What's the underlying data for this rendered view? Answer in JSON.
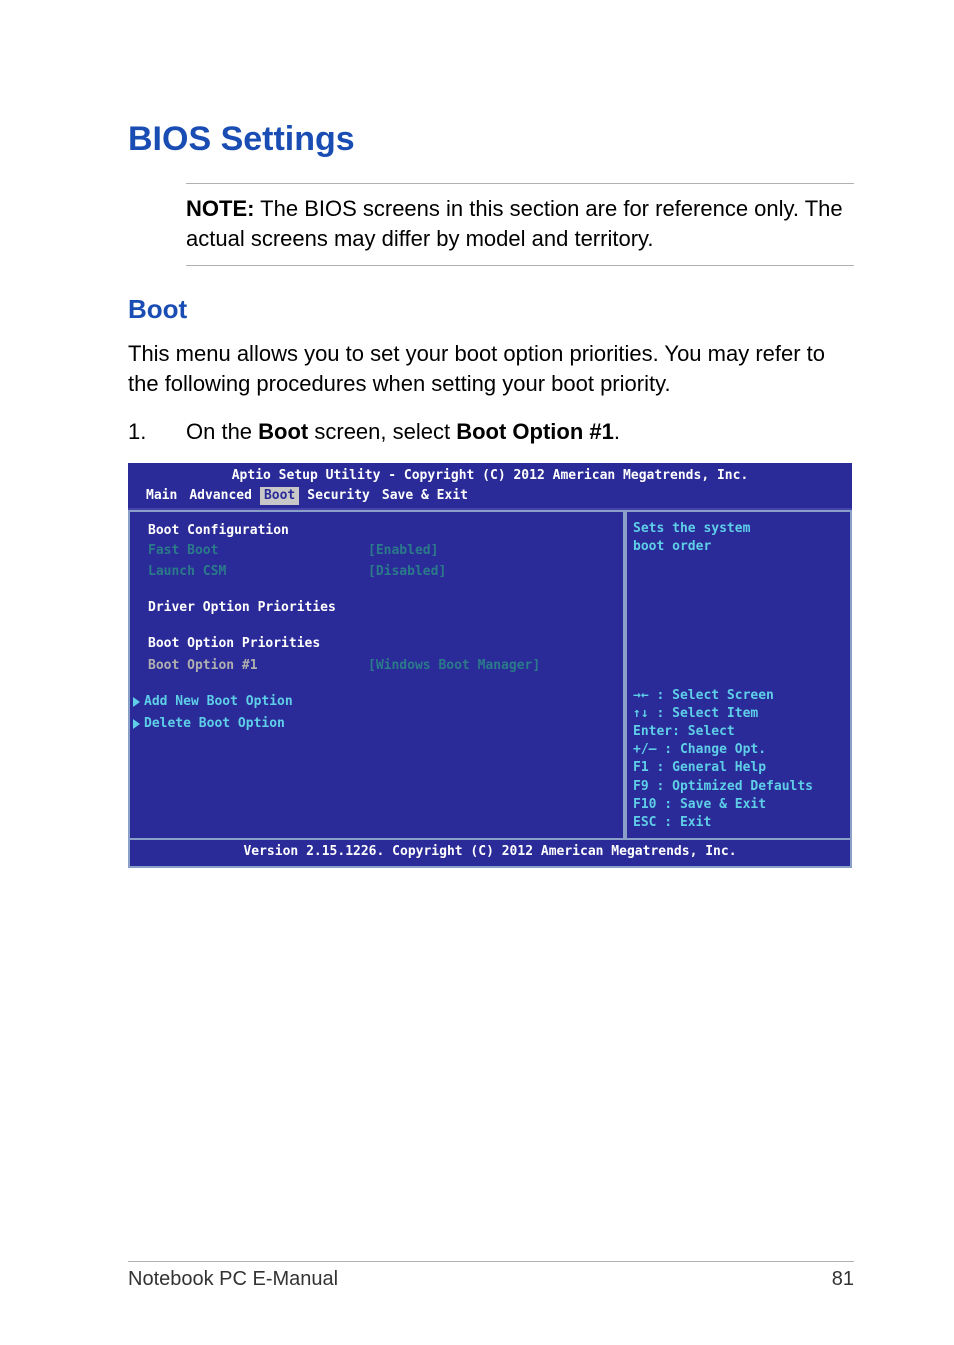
{
  "page": {
    "title": "BIOS Settings",
    "note_label": "NOTE:",
    "note_text": " The BIOS screens in this section are for reference only. The actual screens may differ by model and territory.",
    "sub_heading": "Boot",
    "intro": "This menu allows you to set your boot option priorities. You may refer to the following procedures when setting your boot priority.",
    "step_num": "1.",
    "step_pre": "On the ",
    "step_b1": "Boot",
    "step_mid": " screen, select ",
    "step_b2": "Boot Option #1",
    "step_post": "."
  },
  "bios": {
    "title": "Aptio Setup Utility - Copyright (C) 2012 American Megatrends, Inc.",
    "tabs": {
      "main": "Main",
      "advanced": "Advanced",
      "boot": "Boot",
      "security": "Security",
      "save_exit": "Save & Exit"
    },
    "active_tab": "Boot",
    "left": {
      "boot_config": "Boot Configuration",
      "fast_boot_label": "Fast Boot",
      "fast_boot_value": "[Enabled]",
      "launch_csm_label": "Launch CSM",
      "launch_csm_value": "[Disabled]",
      "driver_option": "Driver Option Priorities",
      "boot_option_prio": "Boot Option Priorities",
      "boot_option1_label": "Boot Option #1",
      "boot_option1_value": "[Windows Boot Manager]",
      "add_new": "Add New Boot Option",
      "delete": "Delete Boot Option"
    },
    "right": {
      "help1": "Sets the system",
      "help2": "boot order",
      "k1": "→←  : Select Screen",
      "k2": "↑↓  : Select Item",
      "k3": "Enter: Select",
      "k4": "+/—  : Change Opt.",
      "k5": "F1   : General Help",
      "k6": "F9   : Optimized Defaults",
      "k7": "F10  : Save & Exit",
      "k8": "ESC  : Exit"
    },
    "footer": "Version 2.15.1226. Copyright (C) 2012 American Megatrends, Inc."
  },
  "footer": {
    "left": "Notebook PC E-Manual",
    "right": "81"
  }
}
